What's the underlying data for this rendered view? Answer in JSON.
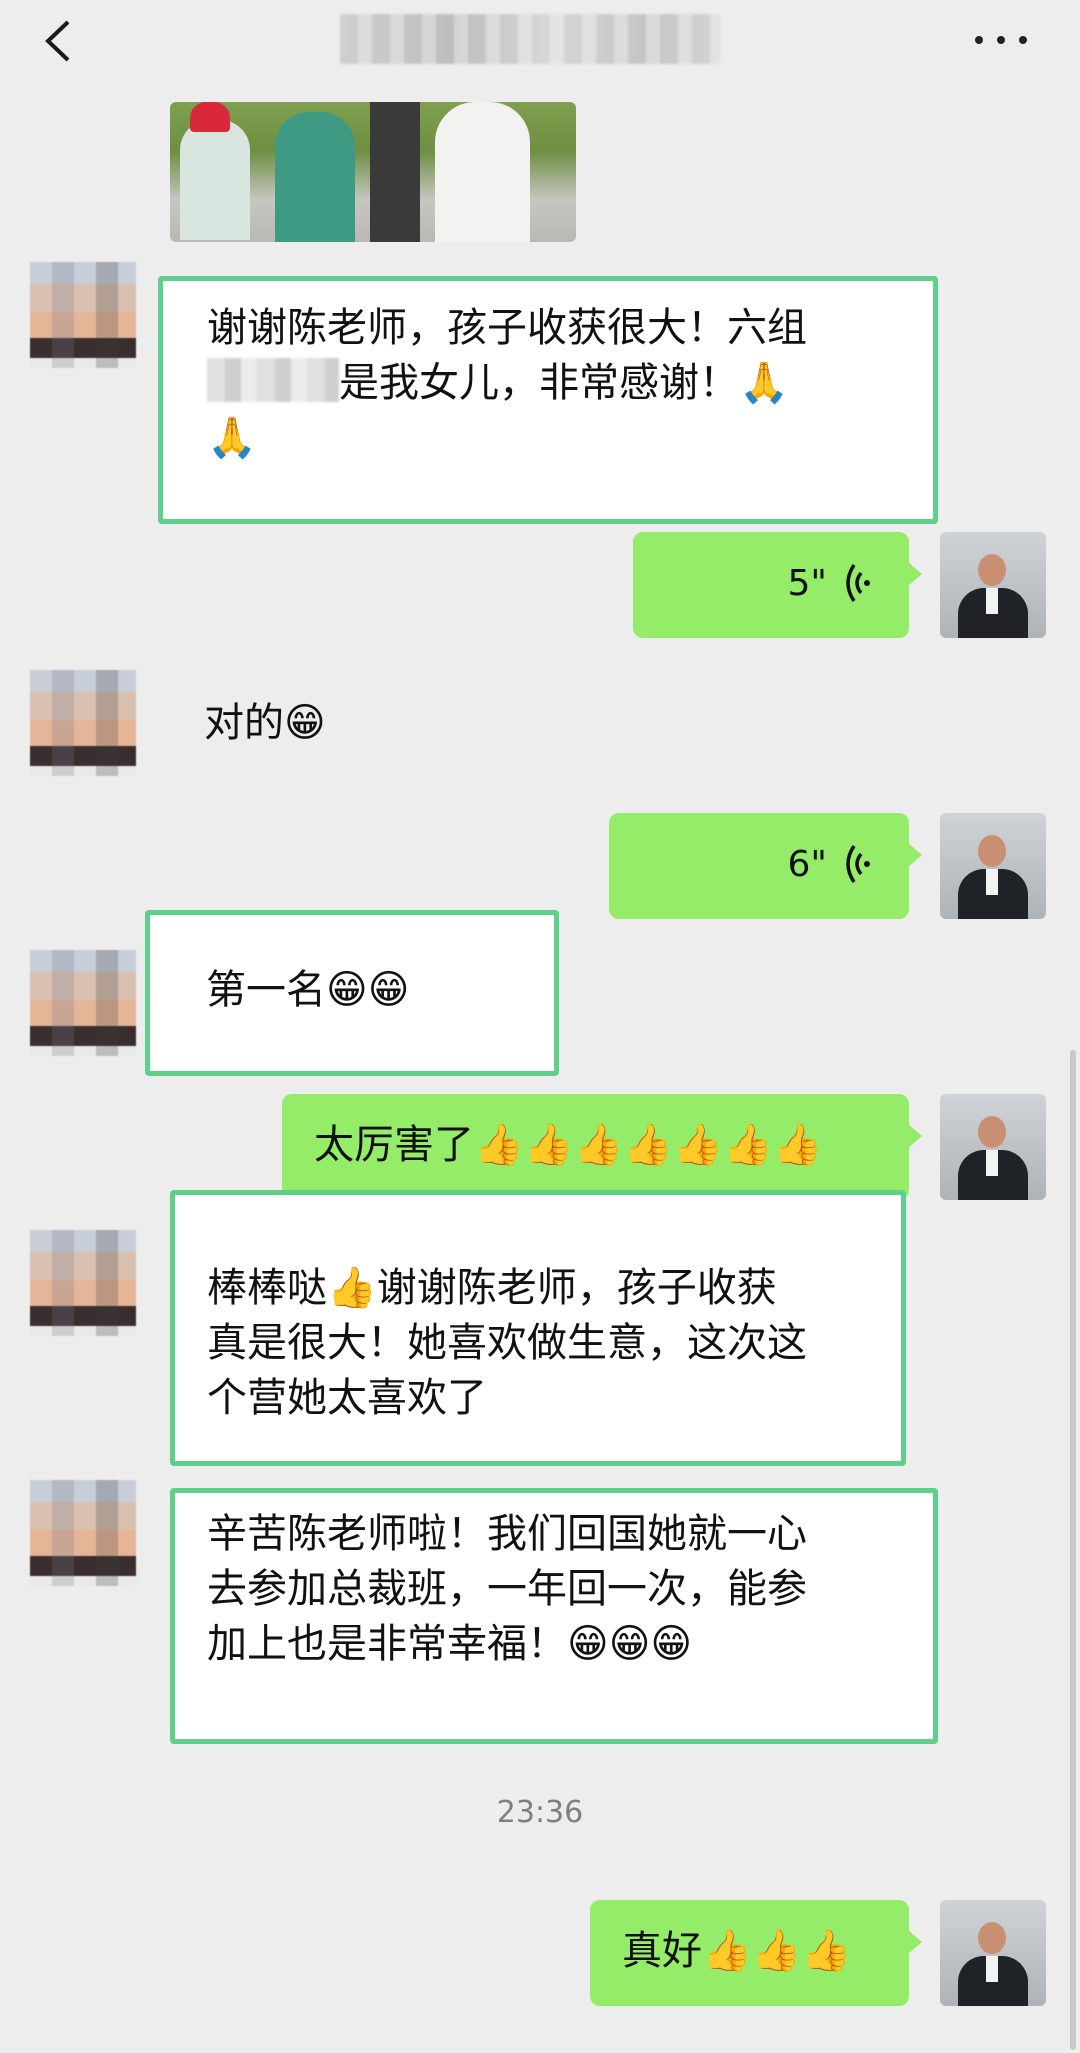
{
  "header": {
    "title": "",
    "back_icon": "chevron-left-icon",
    "more_icon": "more-dots-icon"
  },
  "messages": {
    "m1": {
      "line1": "谢谢陈老师，孩子收获很大！六组",
      "line2": "是我女儿，非常感谢！🙏",
      "line3": "🙏"
    },
    "m2": {
      "duration": "5\""
    },
    "m3": {
      "text": "对的😁"
    },
    "m4": {
      "duration": "6\""
    },
    "m5": {
      "text": "第一名😁😁"
    },
    "m6": {
      "text": "太厉害了👍👍👍👍👍👍👍"
    },
    "m7": {
      "line1": "棒棒哒👍谢谢陈老师，孩子收获",
      "line2": "真是很大！她喜欢做生意，这次这",
      "line3": "个营她太喜欢了"
    },
    "m8": {
      "line1": "辛苦陈老师啦！我们回国她就一心",
      "line2": "去参加总裁班，一年回一次，能参",
      "line3": "加上也是非常幸福！😁😁😁"
    },
    "timestamp": "23:36",
    "m9": {
      "text": "真好👍👍👍"
    }
  },
  "colors": {
    "background": "#ededed",
    "outgoing_bubble": "#95ec69",
    "highlight_border": "#5fd08c",
    "timestamp": "#7f7f7f"
  }
}
